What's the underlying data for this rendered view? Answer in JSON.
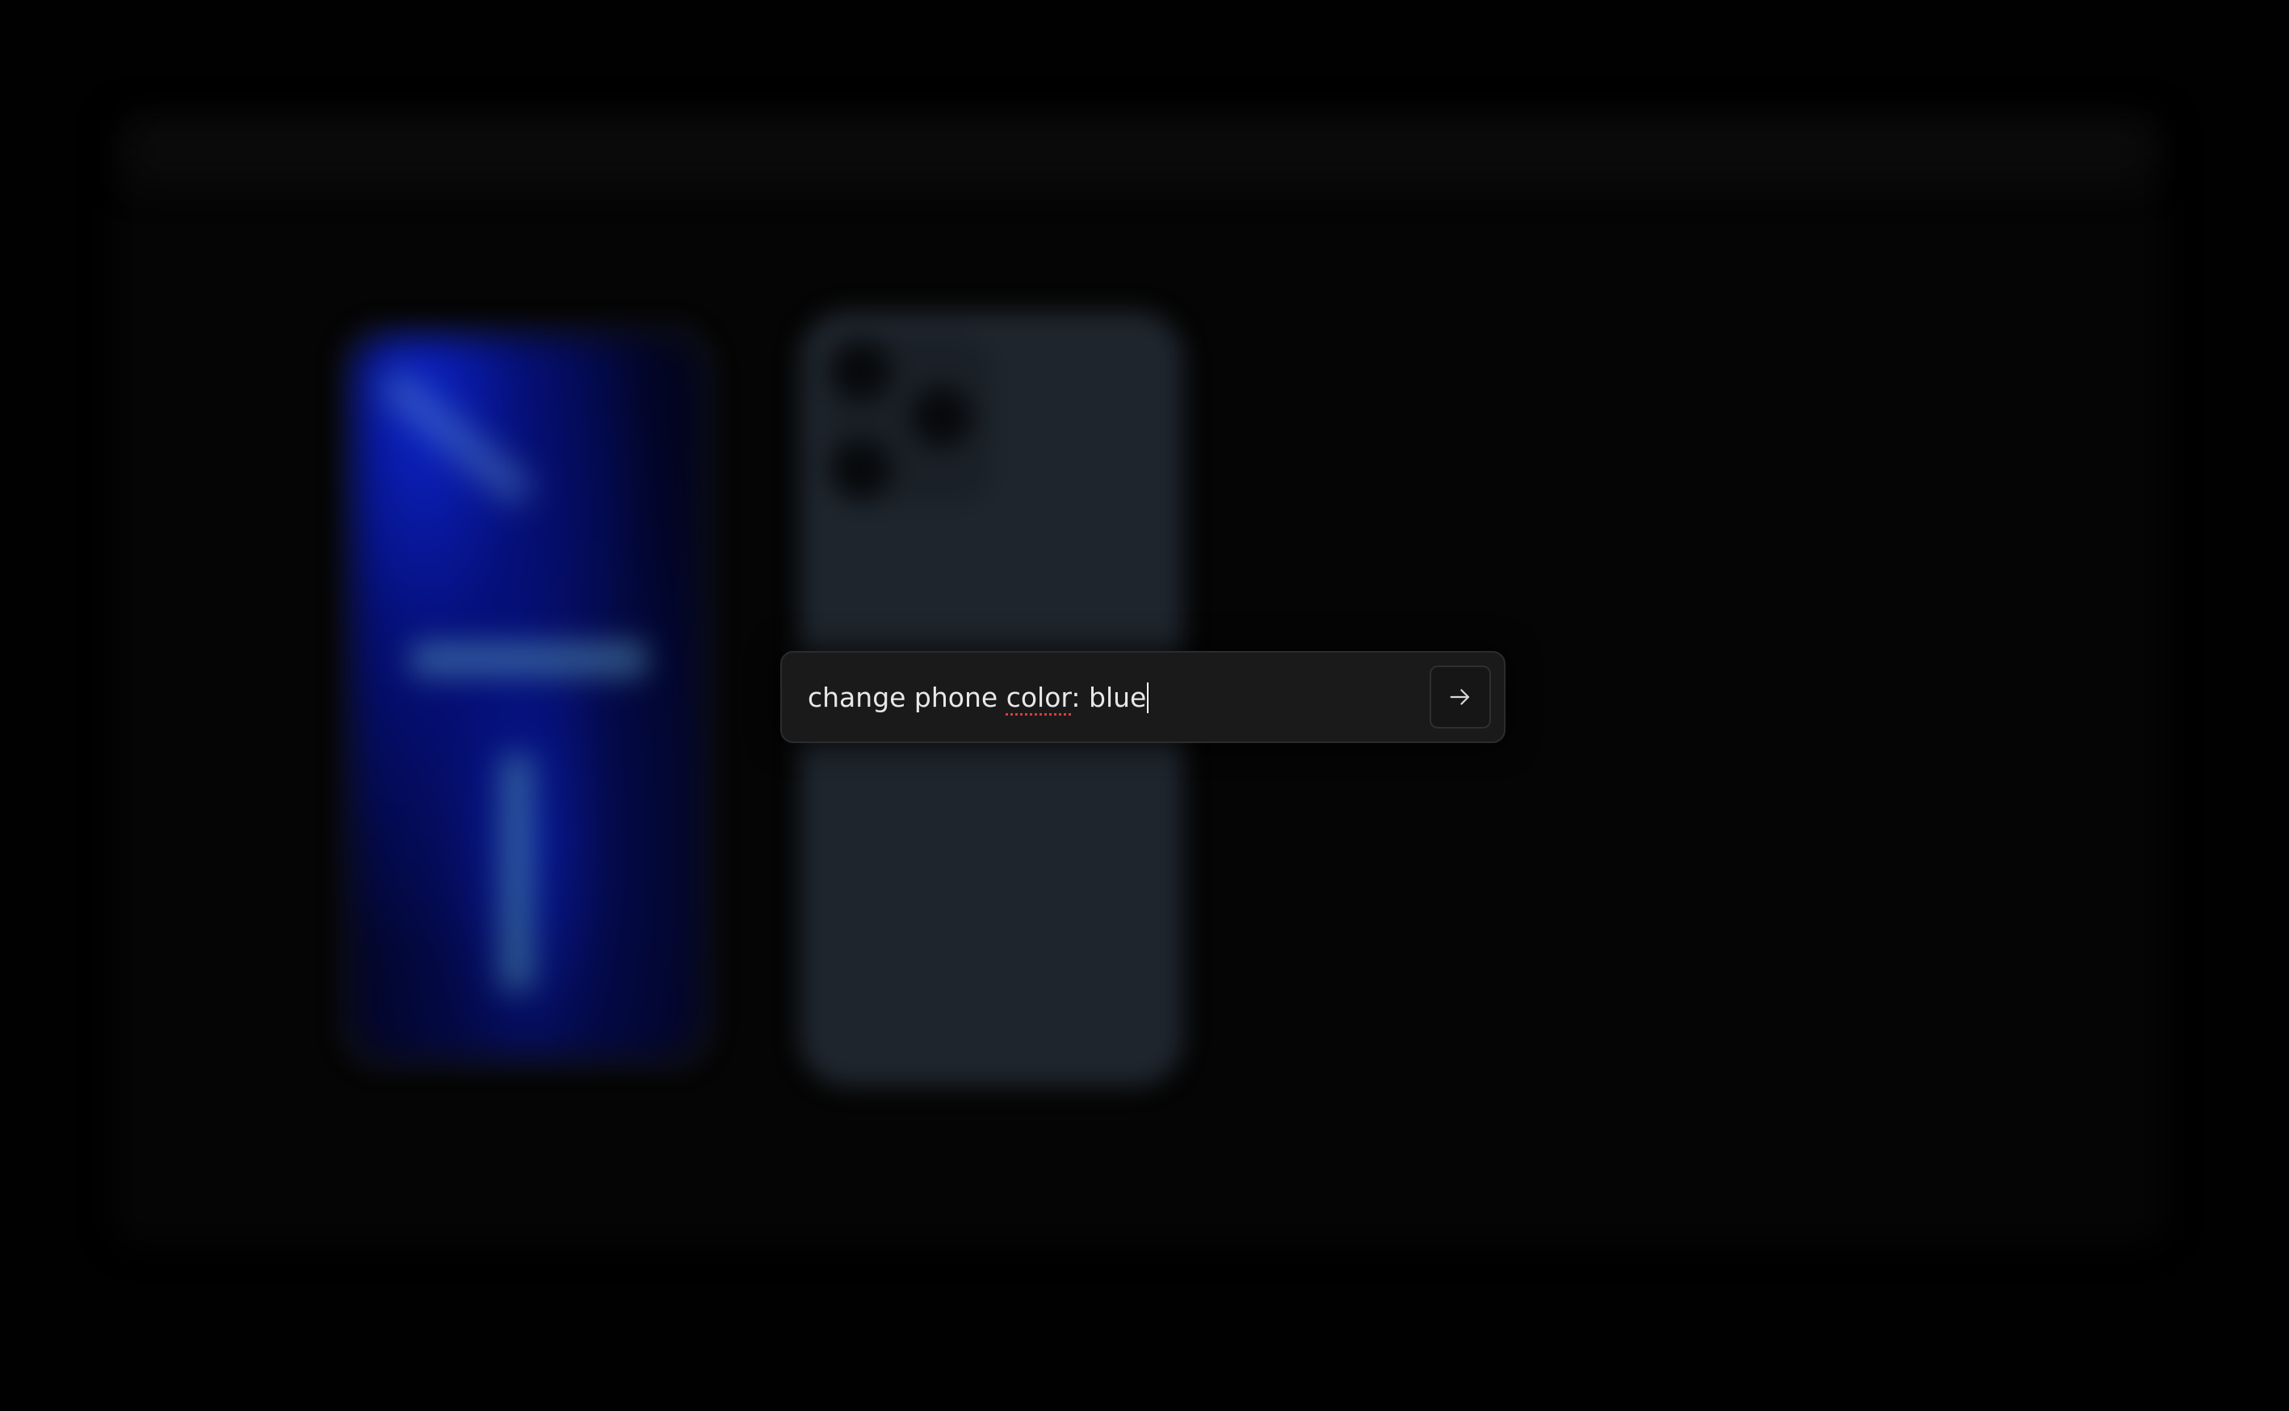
{
  "prompt": {
    "value_part1": "change phone ",
    "value_misspelled": "color",
    "value_part2": ": blue",
    "submit_icon": "arrow-right-icon"
  },
  "colors": {
    "background": "#000000",
    "prompt_bar": "#1a1a1a",
    "text": "#e8e8e8",
    "phone_screen_blue": "#0c23c9",
    "phone_back": "#1e252d"
  }
}
